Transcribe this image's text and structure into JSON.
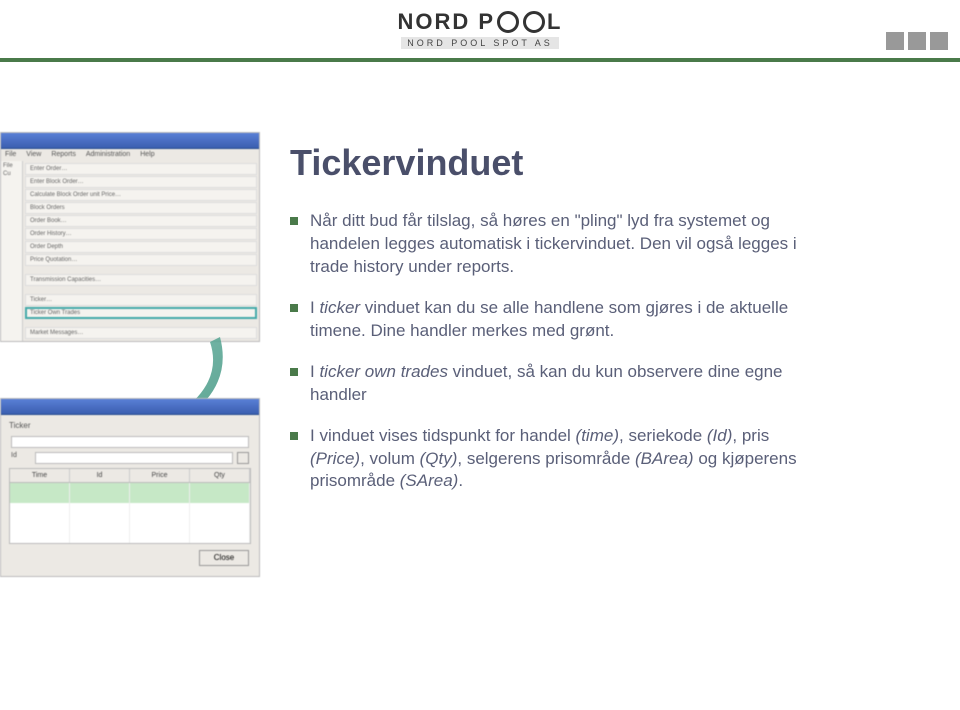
{
  "header": {
    "logo_left": "NORD",
    "logo_right": "P   L",
    "logo_sub": "NORD POOL SPOT AS"
  },
  "title": "Tickervinduet",
  "bullets": [
    "Når ditt bud får tilslag, så høres en \"pling\" lyd fra systemet og handelen legges automatisk i tickervinduet. Den vil også legges i trade history under reports.",
    "I ticker vinduet kan du se alle handlene som gjøres i de aktuelle timene. Dine handler merkes med grønt.",
    "I ticker own trades vinduet, så kan du kun observere dine egne handler",
    "I vinduet vises tidspunkt for handel (time), seriekode (Id), pris (Price), volum (Qty), selgerens prisområde (BArea) og kjøperens prisområde (SArea)."
  ],
  "mock_menu_items": [
    "File",
    "View",
    "Reports",
    "Administration",
    "Help"
  ],
  "mock_list_items": [
    "Enter Order…",
    "Enter Block Order…",
    "Calculate Block Order unit Price…",
    "Block Orders",
    "Order Book…",
    "Order History…",
    "Order Depth",
    "Price Quotation…",
    "",
    "Transmission Capacities…",
    "",
    "Ticker…",
    "Ticker Own Trades",
    "",
    "Market Messages…"
  ],
  "mock_table_headers": [
    "Time",
    "Id",
    "Price",
    "Qty"
  ],
  "mock_button": "Close",
  "mock_side_labels": [
    "File",
    "Cu"
  ]
}
